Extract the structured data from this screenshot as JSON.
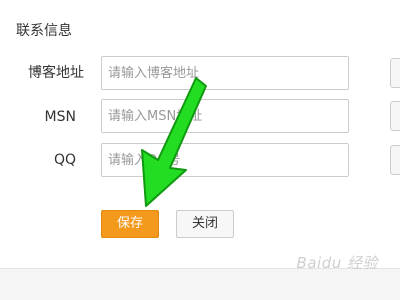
{
  "section": {
    "title": "联系信息"
  },
  "form": {
    "fields": [
      {
        "label": "博客地址",
        "placeholder": "请输入博客地址",
        "value": ""
      },
      {
        "label": "MSN",
        "placeholder": "请输入MSN地址",
        "value": ""
      },
      {
        "label": "QQ",
        "placeholder": "请输入QQ号",
        "value": ""
      }
    ]
  },
  "buttons": {
    "save_label": "保存",
    "close_label": "关闭"
  },
  "annotation": {
    "arrow_color": "#22dd22",
    "arrow_icon": "green-arrow-icon"
  },
  "watermark": {
    "text": "Baidu 经验"
  },
  "colors": {
    "accent": "#f39a1c"
  }
}
